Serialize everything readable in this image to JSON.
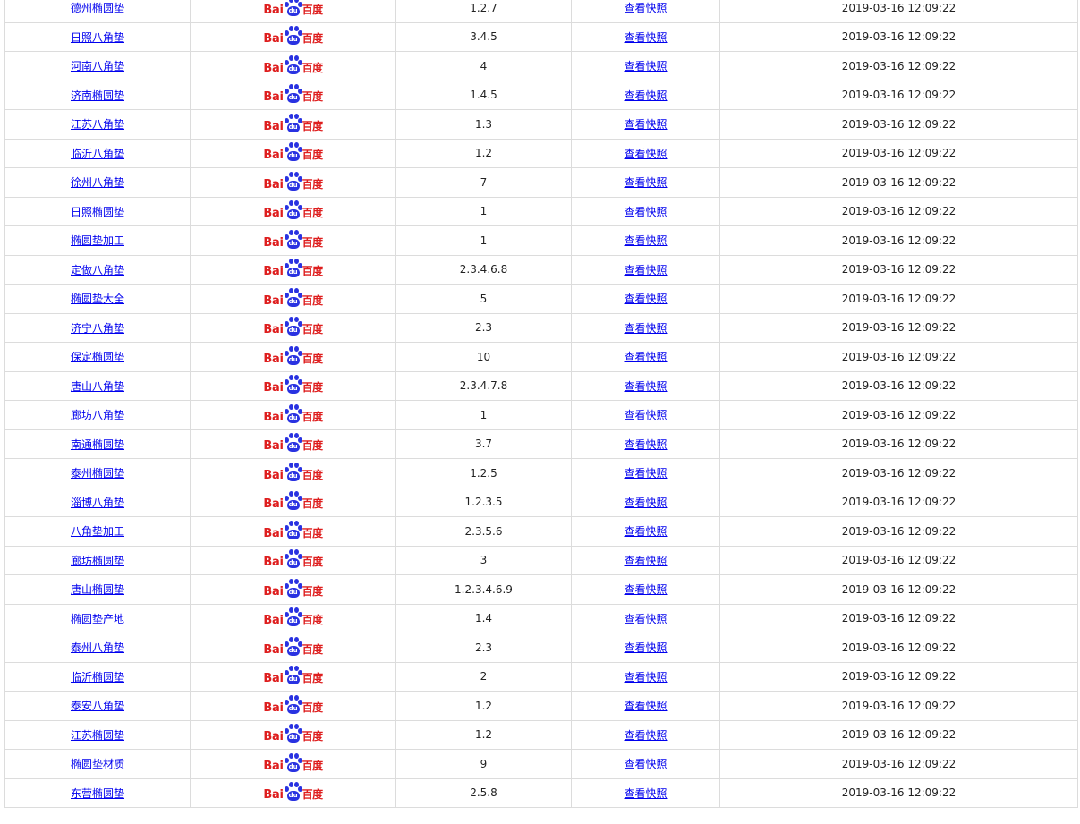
{
  "engine": {
    "name": "Baidu",
    "logo_text_left": "Bai",
    "logo_text_paw": "du",
    "logo_text_cn": "百度"
  },
  "snapshot_label": "查看快照",
  "colors": {
    "link": "#0000ee",
    "logo_red": "#de1e1e",
    "logo_blue": "#2932e1",
    "border": "#dcdcdc"
  },
  "rows": [
    {
      "keyword": "德州椭圆垫",
      "rank": "1.2.7",
      "time": "2019-03-16 12:09:22"
    },
    {
      "keyword": "日照八角垫",
      "rank": "3.4.5",
      "time": "2019-03-16 12:09:22"
    },
    {
      "keyword": "河南八角垫",
      "rank": "4",
      "time": "2019-03-16 12:09:22"
    },
    {
      "keyword": "济南椭圆垫",
      "rank": "1.4.5",
      "time": "2019-03-16 12:09:22"
    },
    {
      "keyword": "江苏八角垫",
      "rank": "1.3",
      "time": "2019-03-16 12:09:22"
    },
    {
      "keyword": "临沂八角垫",
      "rank": "1.2",
      "time": "2019-03-16 12:09:22"
    },
    {
      "keyword": "徐州八角垫",
      "rank": "7",
      "time": "2019-03-16 12:09:22"
    },
    {
      "keyword": "日照椭圆垫",
      "rank": "1",
      "time": "2019-03-16 12:09:22"
    },
    {
      "keyword": "椭圆垫加工",
      "rank": "1",
      "time": "2019-03-16 12:09:22"
    },
    {
      "keyword": "定做八角垫",
      "rank": "2.3.4.6.8",
      "time": "2019-03-16 12:09:22"
    },
    {
      "keyword": "椭圆垫大全",
      "rank": "5",
      "time": "2019-03-16 12:09:22"
    },
    {
      "keyword": "济宁八角垫",
      "rank": "2.3",
      "time": "2019-03-16 12:09:22"
    },
    {
      "keyword": "保定椭圆垫",
      "rank": "10",
      "time": "2019-03-16 12:09:22"
    },
    {
      "keyword": "唐山八角垫",
      "rank": "2.3.4.7.8",
      "time": "2019-03-16 12:09:22"
    },
    {
      "keyword": "廊坊八角垫",
      "rank": "1",
      "time": "2019-03-16 12:09:22"
    },
    {
      "keyword": "南通椭圆垫",
      "rank": "3.7",
      "time": "2019-03-16 12:09:22"
    },
    {
      "keyword": "泰州椭圆垫",
      "rank": "1.2.5",
      "time": "2019-03-16 12:09:22"
    },
    {
      "keyword": "淄博八角垫",
      "rank": "1.2.3.5",
      "time": "2019-03-16 12:09:22"
    },
    {
      "keyword": "八角垫加工",
      "rank": "2.3.5.6",
      "time": "2019-03-16 12:09:22"
    },
    {
      "keyword": "廊坊椭圆垫",
      "rank": "3",
      "time": "2019-03-16 12:09:22"
    },
    {
      "keyword": "唐山椭圆垫",
      "rank": "1.2.3.4.6.9",
      "time": "2019-03-16 12:09:22"
    },
    {
      "keyword": "椭圆垫产地",
      "rank": "1.4",
      "time": "2019-03-16 12:09:22"
    },
    {
      "keyword": "泰州八角垫",
      "rank": "2.3",
      "time": "2019-03-16 12:09:22"
    },
    {
      "keyword": "临沂椭圆垫",
      "rank": "2",
      "time": "2019-03-16 12:09:22"
    },
    {
      "keyword": "泰安八角垫",
      "rank": "1.2",
      "time": "2019-03-16 12:09:22"
    },
    {
      "keyword": "江苏椭圆垫",
      "rank": "1.2",
      "time": "2019-03-16 12:09:22"
    },
    {
      "keyword": "椭圆垫材质",
      "rank": "9",
      "time": "2019-03-16 12:09:22"
    },
    {
      "keyword": "东营椭圆垫",
      "rank": "2.5.8",
      "time": "2019-03-16 12:09:22"
    }
  ]
}
